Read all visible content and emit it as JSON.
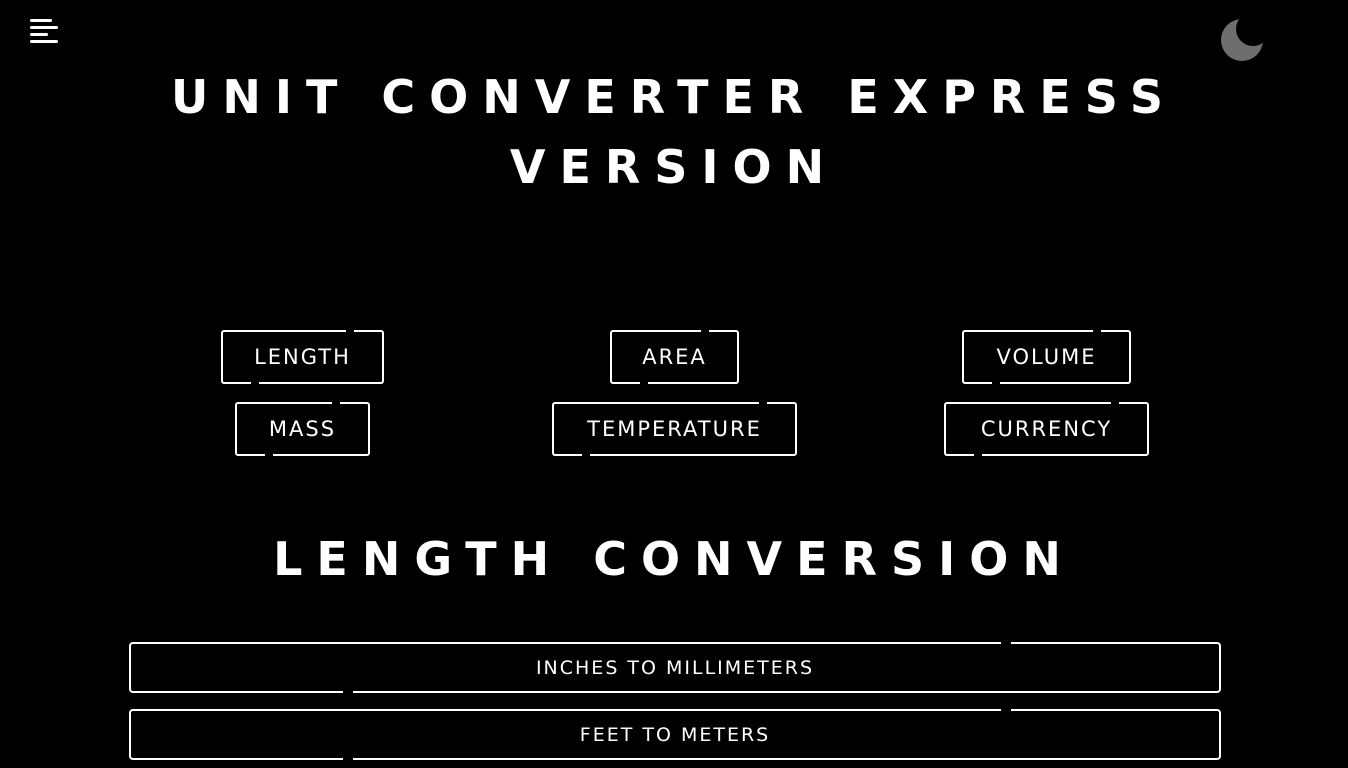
{
  "header": {
    "title_line1": "UNIT CONVERTER EXPRESS",
    "title_line2": "VERSION",
    "menu_icon": "hamburger-menu-icon",
    "theme_icon": "moon-icon"
  },
  "categories": [
    {
      "label": "LENGTH"
    },
    {
      "label": "AREA"
    },
    {
      "label": "VOLUME"
    },
    {
      "label": "MASS"
    },
    {
      "label": "TEMPERATURE"
    },
    {
      "label": "CURRENCY"
    }
  ],
  "section": {
    "title": "LENGTH CONVERSION"
  },
  "conversions": [
    {
      "label": "INCHES TO MILLIMETERS"
    },
    {
      "label": "FEET TO METERS"
    }
  ],
  "colors": {
    "background": "#000000",
    "foreground": "#ffffff",
    "moon": "#6e6e6e"
  }
}
